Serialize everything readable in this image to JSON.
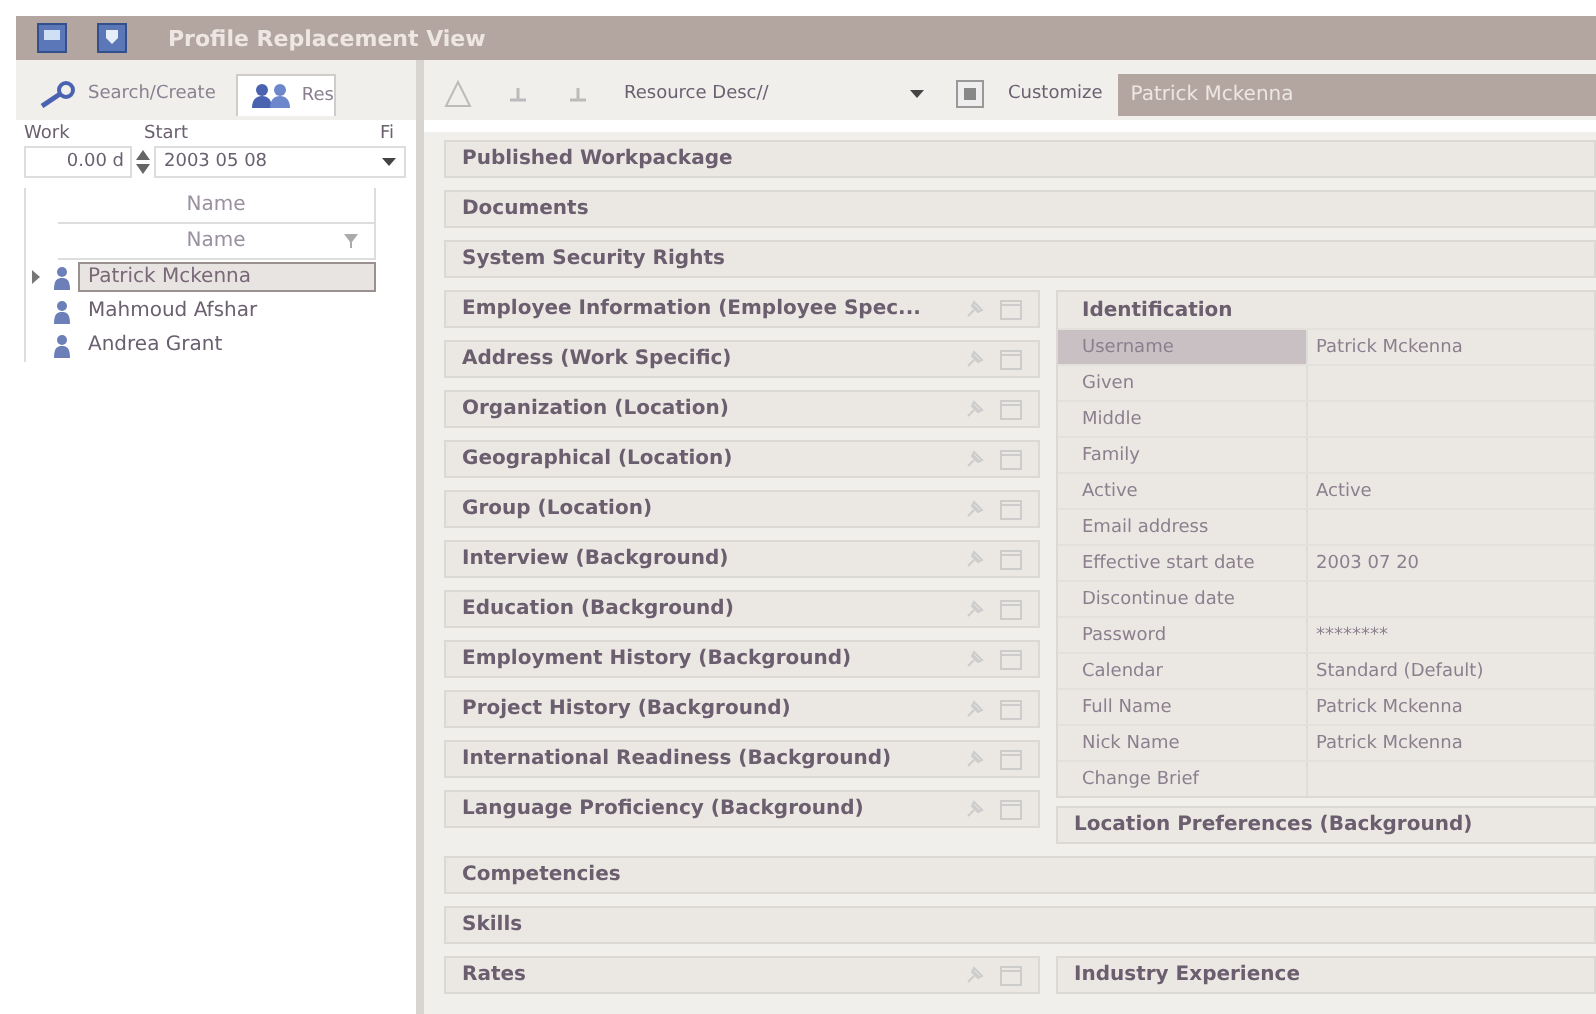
{
  "window": {
    "title": "Profile Replacement View"
  },
  "left_panel": {
    "tabs": [
      {
        "label": "Search/Create",
        "selected": false
      },
      {
        "label": "Res",
        "selected": true
      }
    ],
    "filter": {
      "columns": [
        "Work",
        "Start",
        "Fi"
      ],
      "work": "0.00 d",
      "start": "2003 05 08"
    },
    "grid": {
      "group_header": "Name",
      "column": "Name",
      "rows": [
        {
          "name": "Patrick Mckenna",
          "selected": true
        },
        {
          "name": "Mahmoud Afshar",
          "selected": false
        },
        {
          "name": "Andrea Grant",
          "selected": false
        }
      ]
    }
  },
  "toolbar": {
    "view_dropdown": "Resource Desc//",
    "customize": "Customize",
    "current_resource": "Patrick Mckenna"
  },
  "sections_top": [
    "Published Workpackage",
    "Documents",
    "System Security Rights"
  ],
  "sections_left": [
    "Employee Information (Employee Spec...",
    "Address (Work Specific)",
    "Organization (Location)",
    "Geographical (Location)",
    "Group (Location)",
    "Interview (Background)",
    "Education (Background)",
    "Employment History (Background)",
    "Project History (Background)",
    "International Readiness (Background)",
    "Language Proficiency (Background)"
  ],
  "identification": {
    "title": "Identification",
    "properties": [
      {
        "label": "Username",
        "value": "Patrick Mckenna",
        "selected": true
      },
      {
        "label": "Given",
        "selected": false
      },
      {
        "label": "Middle",
        "selected": false
      },
      {
        "label": "Family",
        "selected": false
      },
      {
        "label": "Active",
        "value": "Active",
        "selected": false
      },
      {
        "label": "Email address",
        "selected": false
      },
      {
        "label": "Effective start date",
        "value": "2003 07 20",
        "selected": false
      },
      {
        "label": "Discontinue date",
        "selected": false
      },
      {
        "label": "Password",
        "value": "********",
        "selected": false
      },
      {
        "label": "Calendar",
        "value": "Standard (Default)",
        "selected": false
      },
      {
        "label": "Full Name",
        "value": "Patrick Mckenna",
        "selected": false
      },
      {
        "label": "Nick Name",
        "value": "Patrick Mckenna",
        "selected": false
      },
      {
        "label": "Change Brief",
        "selected": false
      }
    ]
  },
  "location_preferences": "Location Preferences (Background)",
  "sections_bottom": [
    "Competencies",
    "Skills"
  ],
  "last_row": {
    "left": "Rates",
    "right": "Industry Experience"
  }
}
